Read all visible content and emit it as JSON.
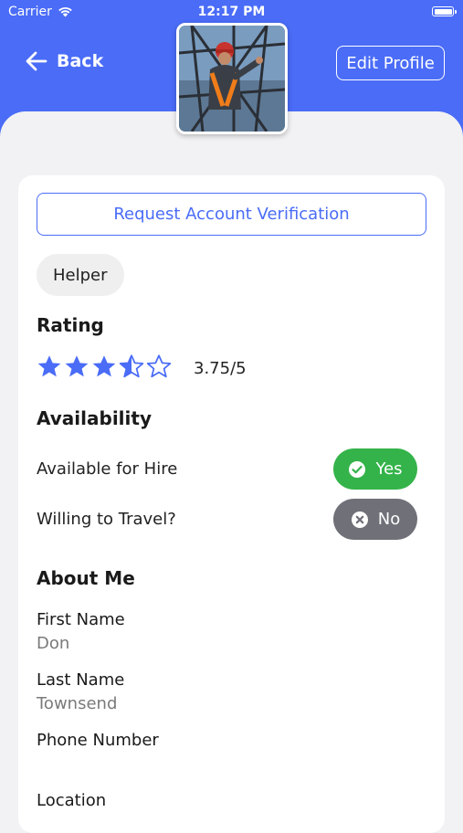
{
  "status_bar": {
    "carrier": "Carrier",
    "time": "12:17 PM"
  },
  "header": {
    "back_label": "Back",
    "edit_label": "Edit Profile",
    "accent_color": "#4a6cf7"
  },
  "profile": {
    "verify_label": "Request Account Verification",
    "role": "Helper",
    "rating_title": "Rating",
    "rating_value": 3.75,
    "rating_text": "3.75/5",
    "availability_title": "Availability",
    "available_label": "Available for Hire",
    "available_status": "Yes",
    "travel_label": "Willing to Travel?",
    "travel_status": "No",
    "about_title": "About Me",
    "first_name_label": "First Name",
    "first_name_value": "Don",
    "last_name_label": "Last Name",
    "last_name_value": "Townsend",
    "phone_label": "Phone Number",
    "phone_value": "",
    "location_label": "Location"
  },
  "colors": {
    "yes": "#34b34a",
    "no": "#707079",
    "star": "#4a6cf7"
  }
}
